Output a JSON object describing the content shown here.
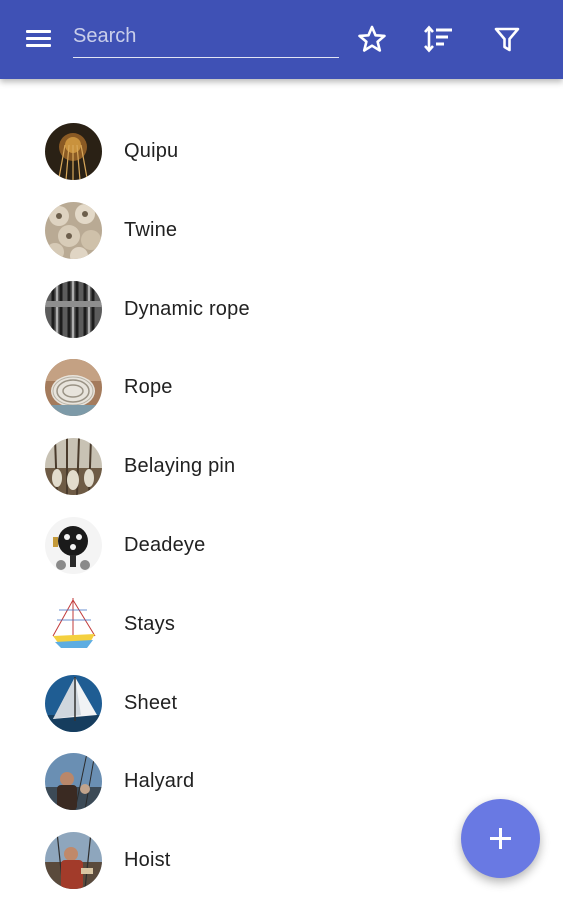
{
  "appbar": {
    "background": "#3f51b5",
    "menu_icon": "menu-icon",
    "search": {
      "placeholder": "Search",
      "value": ""
    },
    "actions": [
      {
        "icon": "star-outline-icon"
      },
      {
        "icon": "sort-icon"
      },
      {
        "icon": "filter-icon"
      }
    ]
  },
  "list": {
    "items": [
      {
        "label": "Quipu",
        "icon": "quipu-thumbnail"
      },
      {
        "label": "Twine",
        "icon": "twine-thumbnail"
      },
      {
        "label": "Dynamic rope",
        "icon": "dynamic-rope-thumbnail"
      },
      {
        "label": "Rope",
        "icon": "rope-thumbnail"
      },
      {
        "label": "Belaying pin",
        "icon": "belaying-pin-thumbnail"
      },
      {
        "label": "Deadeye",
        "icon": "deadeye-thumbnail"
      },
      {
        "label": "Stays",
        "icon": "stays-thumbnail"
      },
      {
        "label": "Sheet",
        "icon": "sheet-thumbnail"
      },
      {
        "label": "Halyard",
        "icon": "halyard-thumbnail"
      },
      {
        "label": "Hoist",
        "icon": "hoist-thumbnail"
      }
    ]
  },
  "fab": {
    "icon": "plus-icon",
    "color": "#6979e3"
  }
}
